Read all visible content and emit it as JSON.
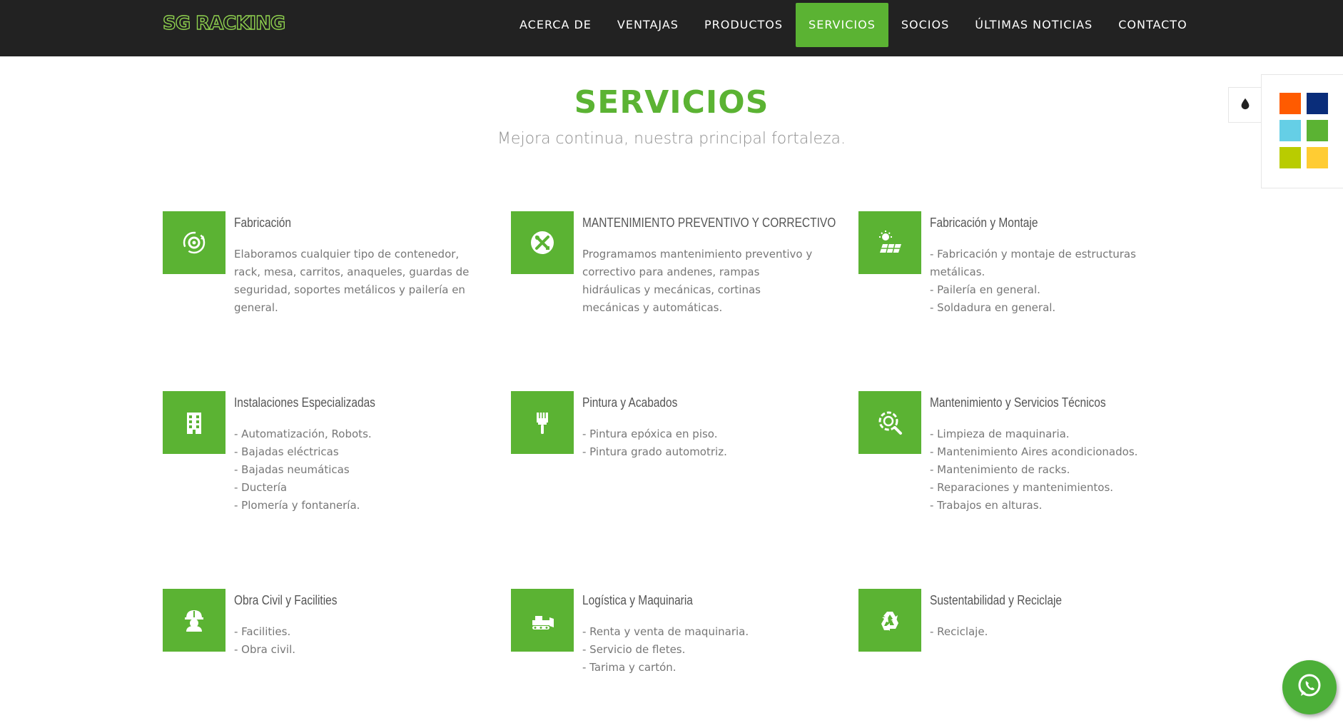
{
  "brand": {
    "logo_text": "SG RACKING"
  },
  "nav": {
    "items": [
      {
        "label": "ACERCA DE"
      },
      {
        "label": "VENTAJAS"
      },
      {
        "label": "PRODUCTOS"
      },
      {
        "label": "SERVICIOS",
        "active": true
      },
      {
        "label": "SOCIOS"
      },
      {
        "label": "ÚLTIMAS NOTICIAS"
      },
      {
        "label": "CONTACTO"
      }
    ]
  },
  "hero": {
    "title": "SERVICIOS",
    "subtitle": "Mejora continua, nuestra principal fortaleza."
  },
  "services": [
    {
      "icon": "gear-cycle-icon",
      "title": "Fabricación",
      "desc": [
        "Elaboramos cualquier tipo de contenedor, rack, mesa, carritos, anaqueles, guardas de seguridad, soportes metálicos y pailería en general."
      ]
    },
    {
      "icon": "tools-icon",
      "title": "MANTENIMIENTO PREVENTIVO Y CORRECTIVO",
      "desc": [
        "Programamos mantenimiento preventivo y correctivo para andenes, rampas hidráulicas y mecánicas, cortinas mecánicas y automáticas."
      ]
    },
    {
      "icon": "solar-panel-icon",
      "title": "Fabricación y Montaje",
      "desc": [
        "- Fabricación y montaje de estructuras metálicas.",
        "- Pailería en general.",
        "- Soldadura en general."
      ]
    },
    {
      "icon": "building-icon",
      "title": "Instalaciones Especializadas",
      "desc": [
        "- Automatización, Robots.",
        "- Bajadas eléctricas",
        "- Bajadas neumáticas",
        "- Ductería",
        "- Plomería y fontanería."
      ]
    },
    {
      "icon": "paint-brush-icon",
      "title": "Pintura y Acabados",
      "desc": [
        "- Pintura epóxica en piso.",
        "- Pintura grado automotriz."
      ]
    },
    {
      "icon": "gear-search-icon",
      "title": "Mantenimiento y Servicios Técnicos",
      "desc": [
        "- Limpieza de maquinaria.",
        "- Mantenimiento Aires acondicionados.",
        "- Mantenimiento de racks.",
        "- Reparaciones y mantenimientos.",
        "- Trabajos en alturas."
      ]
    },
    {
      "icon": "hard-hat-worker-icon",
      "title": "Obra Civil y Facilities",
      "desc": [
        "- Facilities.",
        "- Obra civil."
      ]
    },
    {
      "icon": "bulldozer-icon",
      "title": "Logística y Maquinaria",
      "desc": [
        "- Renta y venta de maquinaria.",
        "- Servicio de fletes.",
        "- Tarima y cartón."
      ]
    },
    {
      "icon": "recycle-icon",
      "title": "Sustentabilidad y Reciclaje",
      "desc": [
        "- Reciclaje."
      ]
    }
  ],
  "color_switcher": {
    "icon": "ink-drop-icon",
    "swatches": [
      "#ff5b00",
      "#0a2d7a",
      "#65cfe6",
      "#5bb333",
      "#b9cc00",
      "#ffcc33"
    ]
  },
  "whatsapp": {
    "icon": "whatsapp-icon"
  },
  "colors": {
    "accent": "#5bb333",
    "navbar": "#222222"
  }
}
